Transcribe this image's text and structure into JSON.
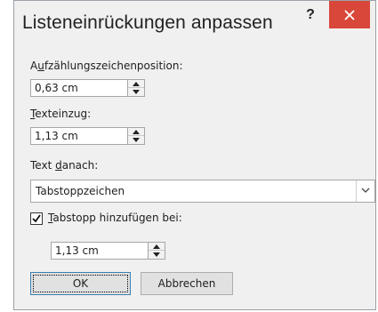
{
  "dialog": {
    "title": "Listeneinrückungen anpassen",
    "help_label": "?"
  },
  "bullet_position": {
    "label_prefix": "A",
    "label_underlined": "u",
    "label_suffix": "fzählungszeichenposition:",
    "value": "0,63 cm"
  },
  "text_indent": {
    "label_underlined": "T",
    "label_suffix": "exteinzug:",
    "value": "1,13 cm"
  },
  "text_after": {
    "label_prefix": "Text ",
    "label_underlined": "d",
    "label_suffix": "anach:",
    "selected": "Tabstoppzeichen"
  },
  "add_tab": {
    "checked": true,
    "label_underlined": "T",
    "label_suffix": "abstopp hinzufügen bei:",
    "value": "1,13 cm"
  },
  "buttons": {
    "ok": "OK",
    "cancel": "Abbrechen"
  },
  "colors": {
    "close_button": "#d9473a",
    "dialog_bg": "#f0f0f0",
    "ok_border": "#3c7fb1"
  },
  "icons": [
    "help-icon",
    "close-icon",
    "spin-up-icon",
    "spin-down-icon",
    "chevron-down-icon",
    "checkmark-icon"
  ]
}
